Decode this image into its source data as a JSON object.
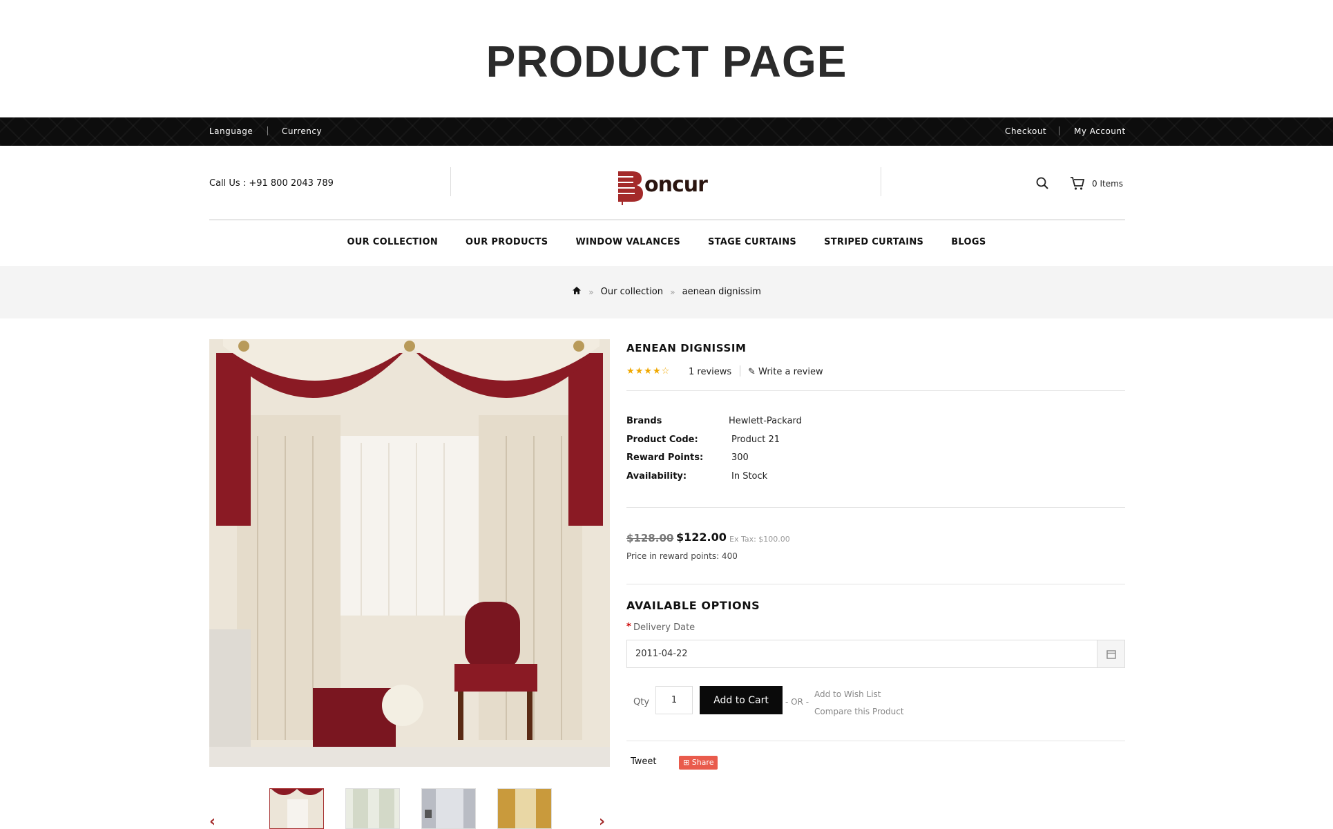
{
  "page": {
    "title": "PRODUCT PAGE"
  },
  "topbar": {
    "left": [
      "Language",
      "Currency"
    ],
    "right": [
      "Checkout",
      "My Account"
    ]
  },
  "header": {
    "call": "Call Us : +91 800 2043 789",
    "logo_text": "oncur",
    "cart": "0 Items"
  },
  "nav": [
    "OUR COLLECTION",
    "OUR PRODUCTS",
    "WINDOW VALANCES",
    "STAGE CURTAINS",
    "STRIPED CURTAINS",
    "BLOGS"
  ],
  "breadcrumb": [
    "Our collection",
    "aenean dignissim"
  ],
  "product": {
    "title": "AENEAN DIGNISSIM",
    "rating": 4,
    "stars": "★★★★☆",
    "reviews": "1 reviews",
    "write_review": "Write a review",
    "specs": [
      {
        "label": "Brands",
        "value": "Hewlett-Packard"
      },
      {
        "label": "Product Code:",
        "value": "Product 21"
      },
      {
        "label": "Reward Points:",
        "value": "300"
      },
      {
        "label": "Availability:",
        "value": "In Stock"
      }
    ],
    "old_price": "$128.00",
    "price": "$122.00",
    "ex_tax": "Ex Tax: $100.00",
    "reward_price": "Price in reward points: 400"
  },
  "options": {
    "title": "AVAILABLE OPTIONS",
    "required_mark": "*",
    "delivery_label": "Delivery Date",
    "delivery_value": "2011-04-22"
  },
  "purchase": {
    "qty_label": "Qty",
    "qty_value": "1",
    "add_to_cart": "Add to Cart",
    "or": "- OR -",
    "wish_list": "Add to Wish List",
    "compare": "Compare this Product"
  },
  "social": {
    "tweet": "Tweet",
    "share": "Share"
  },
  "colors": {
    "accent": "#a42a2a",
    "topbar": "#0d0d0d",
    "button": "#0a0a0a",
    "share": "#e95b4c",
    "star": "#f0a800"
  }
}
